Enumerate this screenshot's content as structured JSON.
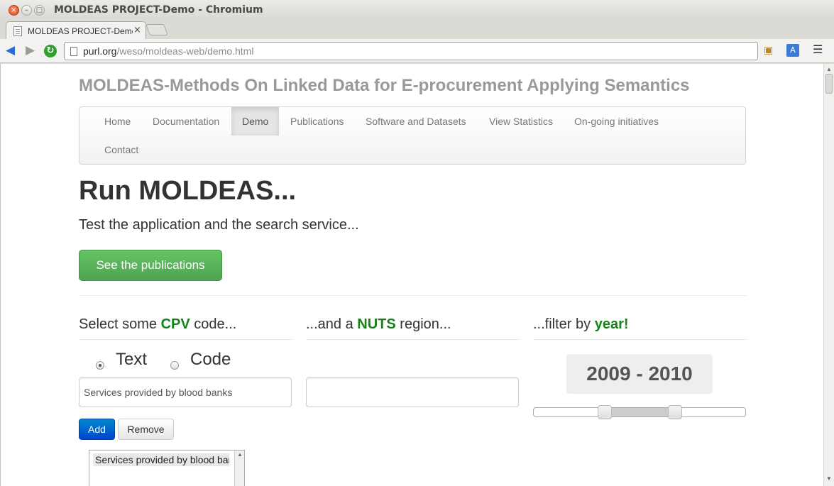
{
  "window": {
    "title": "MOLDEAS PROJECT-Demo - Chromium"
  },
  "browser": {
    "tab_title": "MOLDEAS PROJECT-Demo",
    "url_host": "purl.org",
    "url_path": "/weso/moldeas-web/demo.html"
  },
  "site": {
    "title": "MOLDEAS-Methods On Linked Data for E-procurement Applying Semantics"
  },
  "nav": {
    "items": [
      {
        "label": "Home"
      },
      {
        "label": "Documentation"
      },
      {
        "label": "Demo",
        "active": true
      },
      {
        "label": "Publications"
      },
      {
        "label": "Software and Datasets"
      },
      {
        "label": "View Statistics"
      },
      {
        "label": "On-going initiatives"
      },
      {
        "label": "Contact"
      }
    ]
  },
  "hero": {
    "title": "Run MOLDEAS...",
    "subtitle": "Test the application and the search service...",
    "button_label": "See the publications"
  },
  "cpv": {
    "heading_pre": "Select some ",
    "heading_hl": "CPV",
    "heading_post": " code...",
    "radio_text_label": "Text",
    "radio_code_label": "Code",
    "selected_radio": "Text",
    "input_value": "Services provided by blood banks",
    "add_label": "Add",
    "remove_label": "Remove",
    "selected_items": [
      "Services provided by blood banks"
    ]
  },
  "nuts": {
    "heading_pre": "...and a ",
    "heading_hl": "NUTS",
    "heading_post": " region...",
    "input_value": ""
  },
  "year": {
    "heading_pre": "...filter by ",
    "heading_hl": "year!",
    "range_label": "2009 - 2010",
    "range_start": 2009,
    "range_end": 2010
  },
  "colors": {
    "highlight": "#178217",
    "primary_button": "#0066cc",
    "success_button": "#51a351"
  }
}
